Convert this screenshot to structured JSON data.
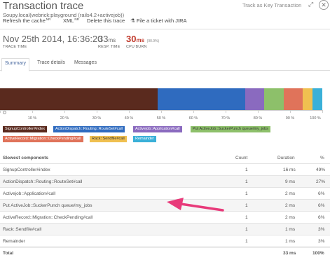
{
  "header": {
    "title": "Transaction trace",
    "subtitle": "Soupy.local(webrick:playground (rails4.2+activejob))",
    "track_link": "Track as Key Transaction",
    "expand_icon": "expand-icon",
    "close_icon": "close-icon"
  },
  "toolbar": {
    "refresh": "Refresh the cache",
    "refresh_badge": "NR",
    "xml": "XML",
    "xml_badge": "NR",
    "delete": "Delete this trace",
    "ticket": "File a ticket with JIRA"
  },
  "stats": {
    "trace_time_value": "Nov 25th 2014, 16:36:20",
    "trace_time_label": "TRACE TIME",
    "resp_time_value": "33",
    "resp_time_unit": "ms",
    "resp_time_label": "RESP. TIME",
    "cpu_burn_value": "30",
    "cpu_burn_unit": "ms",
    "cpu_burn_pct": "(90.9%)",
    "cpu_burn_label": "CPU BURN"
  },
  "tabs": [
    {
      "label": "Summary",
      "active": true
    },
    {
      "label": "Trace details",
      "active": false
    },
    {
      "label": "Messages",
      "active": false
    }
  ],
  "chart_data": {
    "type": "bar",
    "orientation": "horizontal-stacked",
    "xlim": [
      0,
      100
    ],
    "x_ticks": [
      "0",
      "10 %",
      "20 %",
      "30 %",
      "40 %",
      "50 %",
      "60 %",
      "70 %",
      "80 %",
      "90 %",
      "100 %"
    ],
    "series": [
      {
        "name": "SignupController#index",
        "value": 49,
        "color": "#5a2a1e"
      },
      {
        "name": "ActionDispatch::Routing::RouteSet#call",
        "value": 27,
        "color": "#2f6bbf"
      },
      {
        "name": "Activejob::Application#call",
        "value": 6,
        "color": "#8a6abf"
      },
      {
        "name": "Put ActiveJob::SuckerPunch queue/my_jobs",
        "value": 6,
        "color": "#8dc06a"
      },
      {
        "name": "ActiveRecord::Migration::CheckPending#call",
        "value": 6,
        "color": "#e0735a"
      },
      {
        "name": "Rack::Sendfile#call",
        "value": 3,
        "color": "#f0c050"
      },
      {
        "name": "Remainder",
        "value": 3,
        "color": "#3ab0d8"
      }
    ]
  },
  "legend": [
    {
      "label": "SignupController#index",
      "color": "#5a2a1e",
      "text_color": "#ffffff"
    },
    {
      "label": "ActionDispatch::Routing::RouteSet#call",
      "color": "#2f6bbf",
      "text_color": "#ffffff"
    },
    {
      "label": "Activejob::Application#call",
      "color": "#8a6abf",
      "text_color": "#ffffff"
    },
    {
      "label": "Put ActiveJob::SuckerPunch queue/my_jobs",
      "color": "#8dc06a",
      "text_color": "#333333"
    },
    {
      "label": "ActiveRecord::Migration::CheckPending#call",
      "color": "#e0735a",
      "text_color": "#ffffff"
    },
    {
      "label": "Rack::Sendfile#call",
      "color": "#f0c050",
      "text_color": "#333333"
    },
    {
      "label": "Remainder",
      "color": "#3ab0d8",
      "text_color": "#ffffff"
    }
  ],
  "table": {
    "headers": {
      "component": "Slowest components",
      "count": "Count",
      "duration": "Duration",
      "pct": "%"
    },
    "rows": [
      {
        "component": "SignupController#index",
        "count": "1",
        "duration": "16 ms",
        "pct": "49%"
      },
      {
        "component": "ActionDispatch::Routing::RouteSet#call",
        "count": "1",
        "duration": "9 ms",
        "pct": "27%"
      },
      {
        "component": "Activejob::Application#call",
        "count": "1",
        "duration": "2 ms",
        "pct": "6%"
      },
      {
        "component": "Put ActiveJob::SuckerPunch queue/my_jobs",
        "count": "1",
        "duration": "2 ms",
        "pct": "6%"
      },
      {
        "component": "ActiveRecord::Migration::CheckPending#call",
        "count": "1",
        "duration": "2 ms",
        "pct": "6%"
      },
      {
        "component": "Rack::Sendfile#call",
        "count": "1",
        "duration": "1 ms",
        "pct": "3%"
      },
      {
        "component": "Remainder",
        "count": "1",
        "duration": "1 ms",
        "pct": "3%"
      }
    ],
    "total": {
      "component": "Total",
      "duration": "33 ms",
      "pct": "100%"
    }
  },
  "annotation": {
    "arrow_color": "#e83a7a"
  }
}
